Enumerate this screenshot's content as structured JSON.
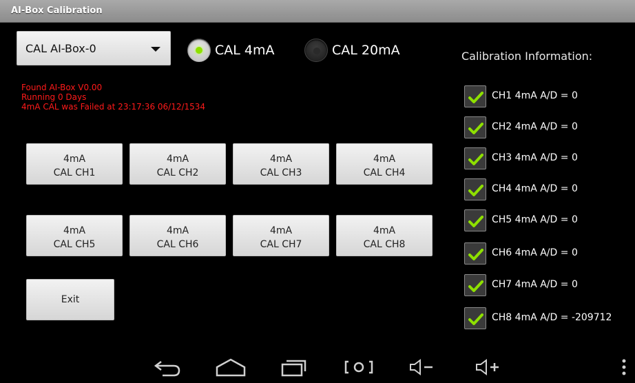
{
  "app": {
    "title": "AI-Box Calibration"
  },
  "device_select": {
    "value": "CAL AI-Box-0"
  },
  "modes": [
    {
      "label": "CAL 4mA",
      "selected": true
    },
    {
      "label": "CAL 20mA",
      "selected": false
    }
  ],
  "status_lines": [
    "Found AI-Box V0.00",
    "Running 0 Days",
    "4mA CAL was Failed at 23:17:36 06/12/1534"
  ],
  "channel_buttons": [
    {
      "line1": "4mA",
      "line2": "CAL CH1"
    },
    {
      "line1": "4mA",
      "line2": "CAL CH2"
    },
    {
      "line1": "4mA",
      "line2": "CAL CH3"
    },
    {
      "line1": "4mA",
      "line2": "CAL CH4"
    },
    {
      "line1": "4mA",
      "line2": "CAL CH5"
    },
    {
      "line1": "4mA",
      "line2": "CAL CH6"
    },
    {
      "line1": "4mA",
      "line2": "CAL CH7"
    },
    {
      "line1": "4mA",
      "line2": "CAL CH8"
    }
  ],
  "exit_label": "Exit",
  "calibration_info": {
    "title": "Calibration Information:",
    "items": [
      {
        "label": "CH1 4mA A/D = 0",
        "checked": true
      },
      {
        "label": "CH2 4mA A/D = 0",
        "checked": true
      },
      {
        "label": "CH3 4mA A/D = 0",
        "checked": true
      },
      {
        "label": "CH4 4mA A/D = 0",
        "checked": true
      },
      {
        "label": "CH5 4mA A/D = 0",
        "checked": true
      },
      {
        "label": "CH6 4mA A/D = 0",
        "checked": true
      },
      {
        "label": "CH7 4mA A/D = 0",
        "checked": true
      },
      {
        "label": "CH8 4mA A/D = -209712",
        "checked": true
      }
    ]
  },
  "nav_icons": [
    "back-icon",
    "home-icon",
    "recent-apps-icon",
    "screenshot-icon",
    "volume-down-icon",
    "volume-up-icon",
    "overflow-menu-icon"
  ],
  "colors": {
    "status_text": "#ff1a1a",
    "check_green": "#8ee000",
    "title_bar": "#9a9a9a"
  }
}
